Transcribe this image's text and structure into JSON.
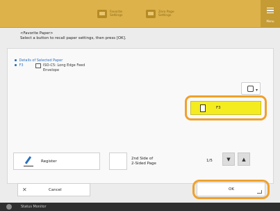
{
  "topbar": {
    "tabs": [
      {
        "label": "Favorite Settings",
        "icon": "favorite-settings-icon"
      },
      {
        "label": "Zero Page Settings",
        "icon": "zero-page-settings-icon"
      }
    ],
    "menu_label": "Menu",
    "menu_icon": "hamburger-icon"
  },
  "heading": {
    "line1": "<Favorite Paper>",
    "line2": "Select a button to recall paper settings, then press [OK]."
  },
  "details": {
    "title": "Details of Selected Paper",
    "code": "F3",
    "paper_icon": "envelope-icon",
    "description": "ISO-C5: Long Edge Feed Envelope"
  },
  "selected_button": {
    "label": "F3",
    "icon": "paper-icon"
  },
  "edit_button": {
    "icon": "settings-pencil-icon",
    "glyph": "▾"
  },
  "register_button": {
    "label": "Register",
    "icon": "pencil-icon"
  },
  "side_button": {
    "label_line1": "2nd Side of",
    "label_line2": "2-Sided Page"
  },
  "pager": {
    "current": "1/5",
    "down": "▼",
    "up": "▲"
  },
  "cancel_button": {
    "label": "Cancel",
    "glyph": "✕"
  },
  "ok_button": {
    "label": "OK"
  },
  "status_bar": {
    "label": "Status Monitor",
    "icon": "status-monitor-icon"
  },
  "colors": {
    "accent": "#ddb24a",
    "highlight": "#f5ec1f",
    "focus_ring": "#f0a12a"
  }
}
